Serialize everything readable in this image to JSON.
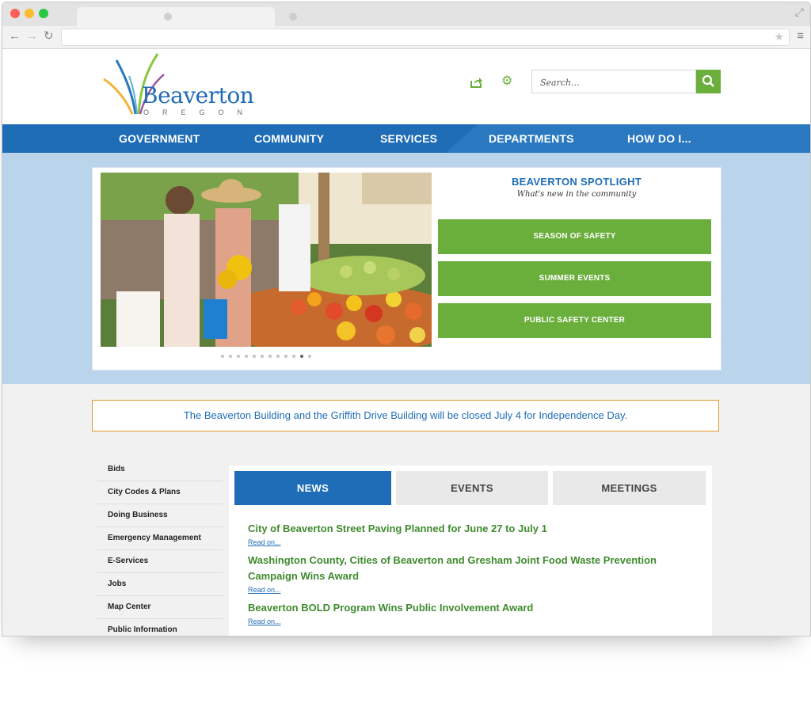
{
  "site": {
    "logo_name": "Beaverton",
    "logo_sub": "OREGON"
  },
  "header": {
    "search_placeholder": "Search..."
  },
  "nav": {
    "items": [
      "GOVERNMENT",
      "COMMUNITY",
      "SERVICES",
      "DEPARTMENTS",
      "HOW DO I..."
    ]
  },
  "spotlight": {
    "title": "BEAVERTON SPOTLIGHT",
    "subtitle": "What's new in the community",
    "buttons": [
      "SEASON OF SAFETY",
      "SUMMER EVENTS",
      "PUBLIC SAFETY CENTER"
    ]
  },
  "alert": {
    "text": "The Beaverton Building and the Griffith Drive Building will be closed July 4 for Independence Day."
  },
  "sidebar": {
    "items": [
      "Bids",
      "City Codes & Plans",
      "Doing Business",
      "Emergency Management",
      "E-Services",
      "Jobs",
      "Map Center",
      "Public Information"
    ]
  },
  "tabs": {
    "labels": [
      "NEWS",
      "EVENTS",
      "MEETINGS"
    ],
    "active": "NEWS"
  },
  "news": {
    "read_on": "Read on...",
    "items": [
      "City of Beaverton Street Paving Planned for June 27 to July 1",
      "Washington County, Cities of Beaverton and Gresham Joint Food Waste Prevention Campaign Wins Award",
      "Beaverton BOLD Program Wins Public Involvement Award"
    ]
  },
  "colors": {
    "brand_blue": "#1f6db6",
    "accent_green": "#6aae3b",
    "alert_border": "#e39b2e"
  },
  "icons": {
    "share": "share-icon",
    "settings": "gear-icon",
    "search": "search-icon"
  }
}
